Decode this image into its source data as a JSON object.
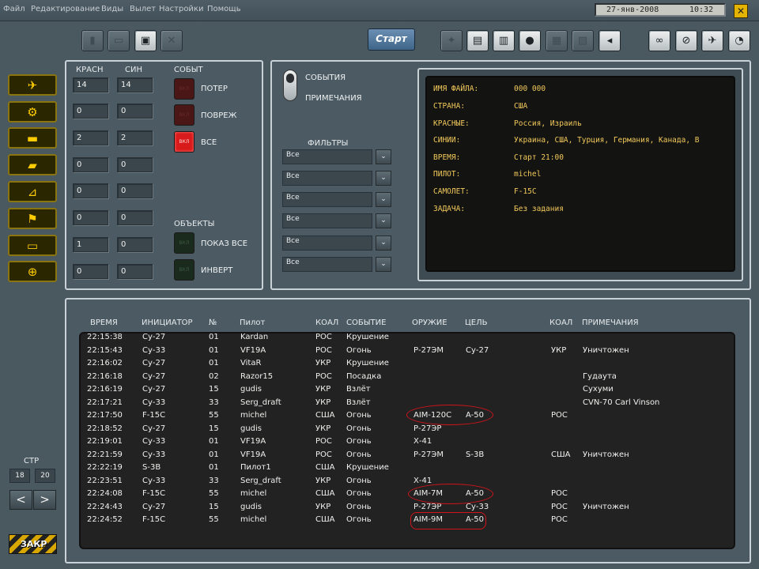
{
  "menu": [
    "Файл",
    "Редактирование",
    "Виды",
    "Вылет",
    "Настройки",
    "Помощь"
  ],
  "date": "27-янв-2008",
  "time": "10:32",
  "start_label": "Старт",
  "icons": {
    "toolbar_left": [
      "file-icon",
      "folder-icon",
      "save-icon",
      "close-icon"
    ],
    "toolbar_mid": [
      "clip-icon",
      "radio-icon",
      "clipboard-icon",
      "pilot-icon",
      "page-icon",
      "film-icon",
      "sound-icon"
    ],
    "toolbar_right": [
      "binoculars-icon",
      "no-entry-icon",
      "aircraft-icon",
      "stopwatch-icon"
    ],
    "units": [
      "jet-icon",
      "helicopter-icon",
      "ship-icon",
      "tank-icon",
      "artillery-icon",
      "sam-icon",
      "truck-icon",
      "target-icon"
    ]
  },
  "counts": {
    "red_header": "КРАСН",
    "blue_header": "СИН",
    "rows": [
      {
        "red": "14",
        "blue": "14"
      },
      {
        "red": "0",
        "blue": "0"
      },
      {
        "red": "2",
        "blue": "2"
      },
      {
        "red": "0",
        "blue": "0"
      },
      {
        "red": "0",
        "blue": "0"
      },
      {
        "red": "0",
        "blue": "0"
      },
      {
        "red": "1",
        "blue": "0"
      },
      {
        "red": "0",
        "blue": "0"
      }
    ]
  },
  "events": {
    "header": "СОБЫТ",
    "losses": "ПОТЕР",
    "damage": "ПОВРЕЖ",
    "all": "ВСЕ",
    "on_label": "ВКЛ"
  },
  "objects": {
    "header": "ОБЪЕКТЫ",
    "show_all": "ПОКАЗ ВСЕ",
    "invert": "ИНВЕРТ"
  },
  "mode": {
    "events": "СОБЫТИЯ",
    "notes": "ПРИМЕЧАНИЯ"
  },
  "filters": {
    "label": "ФИЛЬТРЫ",
    "values": [
      "Все",
      "Все",
      "Все",
      "Все",
      "Все",
      "Все"
    ]
  },
  "info": [
    {
      "k": "ИМЯ ФАЙЛА:",
      "v": "000 000"
    },
    {
      "k": "СТРАНА:",
      "v": "США"
    },
    {
      "k": "КРАСНЫЕ:",
      "v": "Россия, Израиль"
    },
    {
      "k": "СИНИИ:",
      "v": "Украина, США, Турция, Германия, Канада, В"
    },
    {
      "k": "ВРЕМЯ:",
      "v": "Старт 21:00"
    },
    {
      "k": "ПИЛОТ:",
      "v": "michel"
    },
    {
      "k": "САМОЛЕТ:",
      "v": "F-15C"
    },
    {
      "k": "ЗАДАЧА:",
      "v": "Без задания"
    }
  ],
  "log": {
    "headers": [
      "ВРЕМЯ",
      "ИНИЦИАТОР",
      "№",
      "Пилот",
      "КОАЛ",
      "СОБЫТИЕ",
      "ОРУЖИЕ",
      "ЦЕЛЬ",
      "КОАЛ",
      "ПРИМЕЧАНИЯ"
    ],
    "rows": [
      [
        "22:15:38",
        "Су-27",
        "01",
        "Kardan",
        "РОС",
        "Крушение",
        "",
        "",
        "",
        ""
      ],
      [
        "22:15:43",
        "Су-33",
        "01",
        "VF19A",
        "РОС",
        "Огонь",
        "Р-27ЭМ",
        "Су-27",
        "УКР",
        "Уничтожен"
      ],
      [
        "22:16:02",
        "Су-27",
        "01",
        "VitaR",
        "УКР",
        "Крушение",
        "",
        "",
        "",
        ""
      ],
      [
        "22:16:18",
        "Су-27",
        "02",
        "Razor15",
        "РОС",
        "Посадка",
        "",
        "",
        "",
        "Гудаута"
      ],
      [
        "22:16:19",
        "Су-27",
        "15",
        "gudis",
        "УКР",
        "Взлёт",
        "",
        "",
        "",
        "Сухуми"
      ],
      [
        "22:17:21",
        "Су-33",
        "33",
        "Serg_draft",
        "УКР",
        "Взлёт",
        "",
        "",
        "",
        "CVN-70 Carl Vinson"
      ],
      [
        "22:17:50",
        "F-15C",
        "55",
        "michel",
        "США",
        "Огонь",
        "AIM-120C",
        "A-50",
        "РОС",
        ""
      ],
      [
        "22:18:52",
        "Су-27",
        "15",
        "gudis",
        "УКР",
        "Огонь",
        "Р-27ЭР",
        "",
        "",
        ""
      ],
      [
        "22:19:01",
        "Су-33",
        "01",
        "VF19A",
        "РОС",
        "Огонь",
        "Х-41",
        "",
        "",
        ""
      ],
      [
        "22:21:59",
        "Су-33",
        "01",
        "VF19A",
        "РОС",
        "Огонь",
        "Р-27ЭМ",
        "S-3B",
        "США",
        "Уничтожен"
      ],
      [
        "22:22:19",
        "S-3B",
        "01",
        "Пилот1",
        "США",
        "Крушение",
        "",
        "",
        "",
        ""
      ],
      [
        "22:23:51",
        "Су-33",
        "33",
        "Serg_draft",
        "УКР",
        "Огонь",
        "Х-41",
        "",
        "",
        ""
      ],
      [
        "22:24:08",
        "F-15C",
        "55",
        "michel",
        "США",
        "Огонь",
        "AIM-7M",
        "A-50",
        "РОС",
        ""
      ],
      [
        "22:24:43",
        "Су-27",
        "15",
        "gudis",
        "УКР",
        "Огонь",
        "Р-27ЭР",
        "Су-33",
        "РОС",
        "Уничтожен"
      ],
      [
        "22:24:52",
        "F-15C",
        "55",
        "michel",
        "США",
        "Огонь",
        "AIM-9M",
        "A-50",
        "РОС",
        ""
      ]
    ]
  },
  "page": {
    "label": "СТР",
    "current": "18",
    "total": "20",
    "prev": "<",
    "next": ">"
  },
  "close_label": "ЗАКР",
  "colors": {
    "panel": "#4c5b63",
    "accent_yellow": "#ffcc00",
    "screen_text": "#f2c85a",
    "highlight_red": "#d0141c"
  }
}
